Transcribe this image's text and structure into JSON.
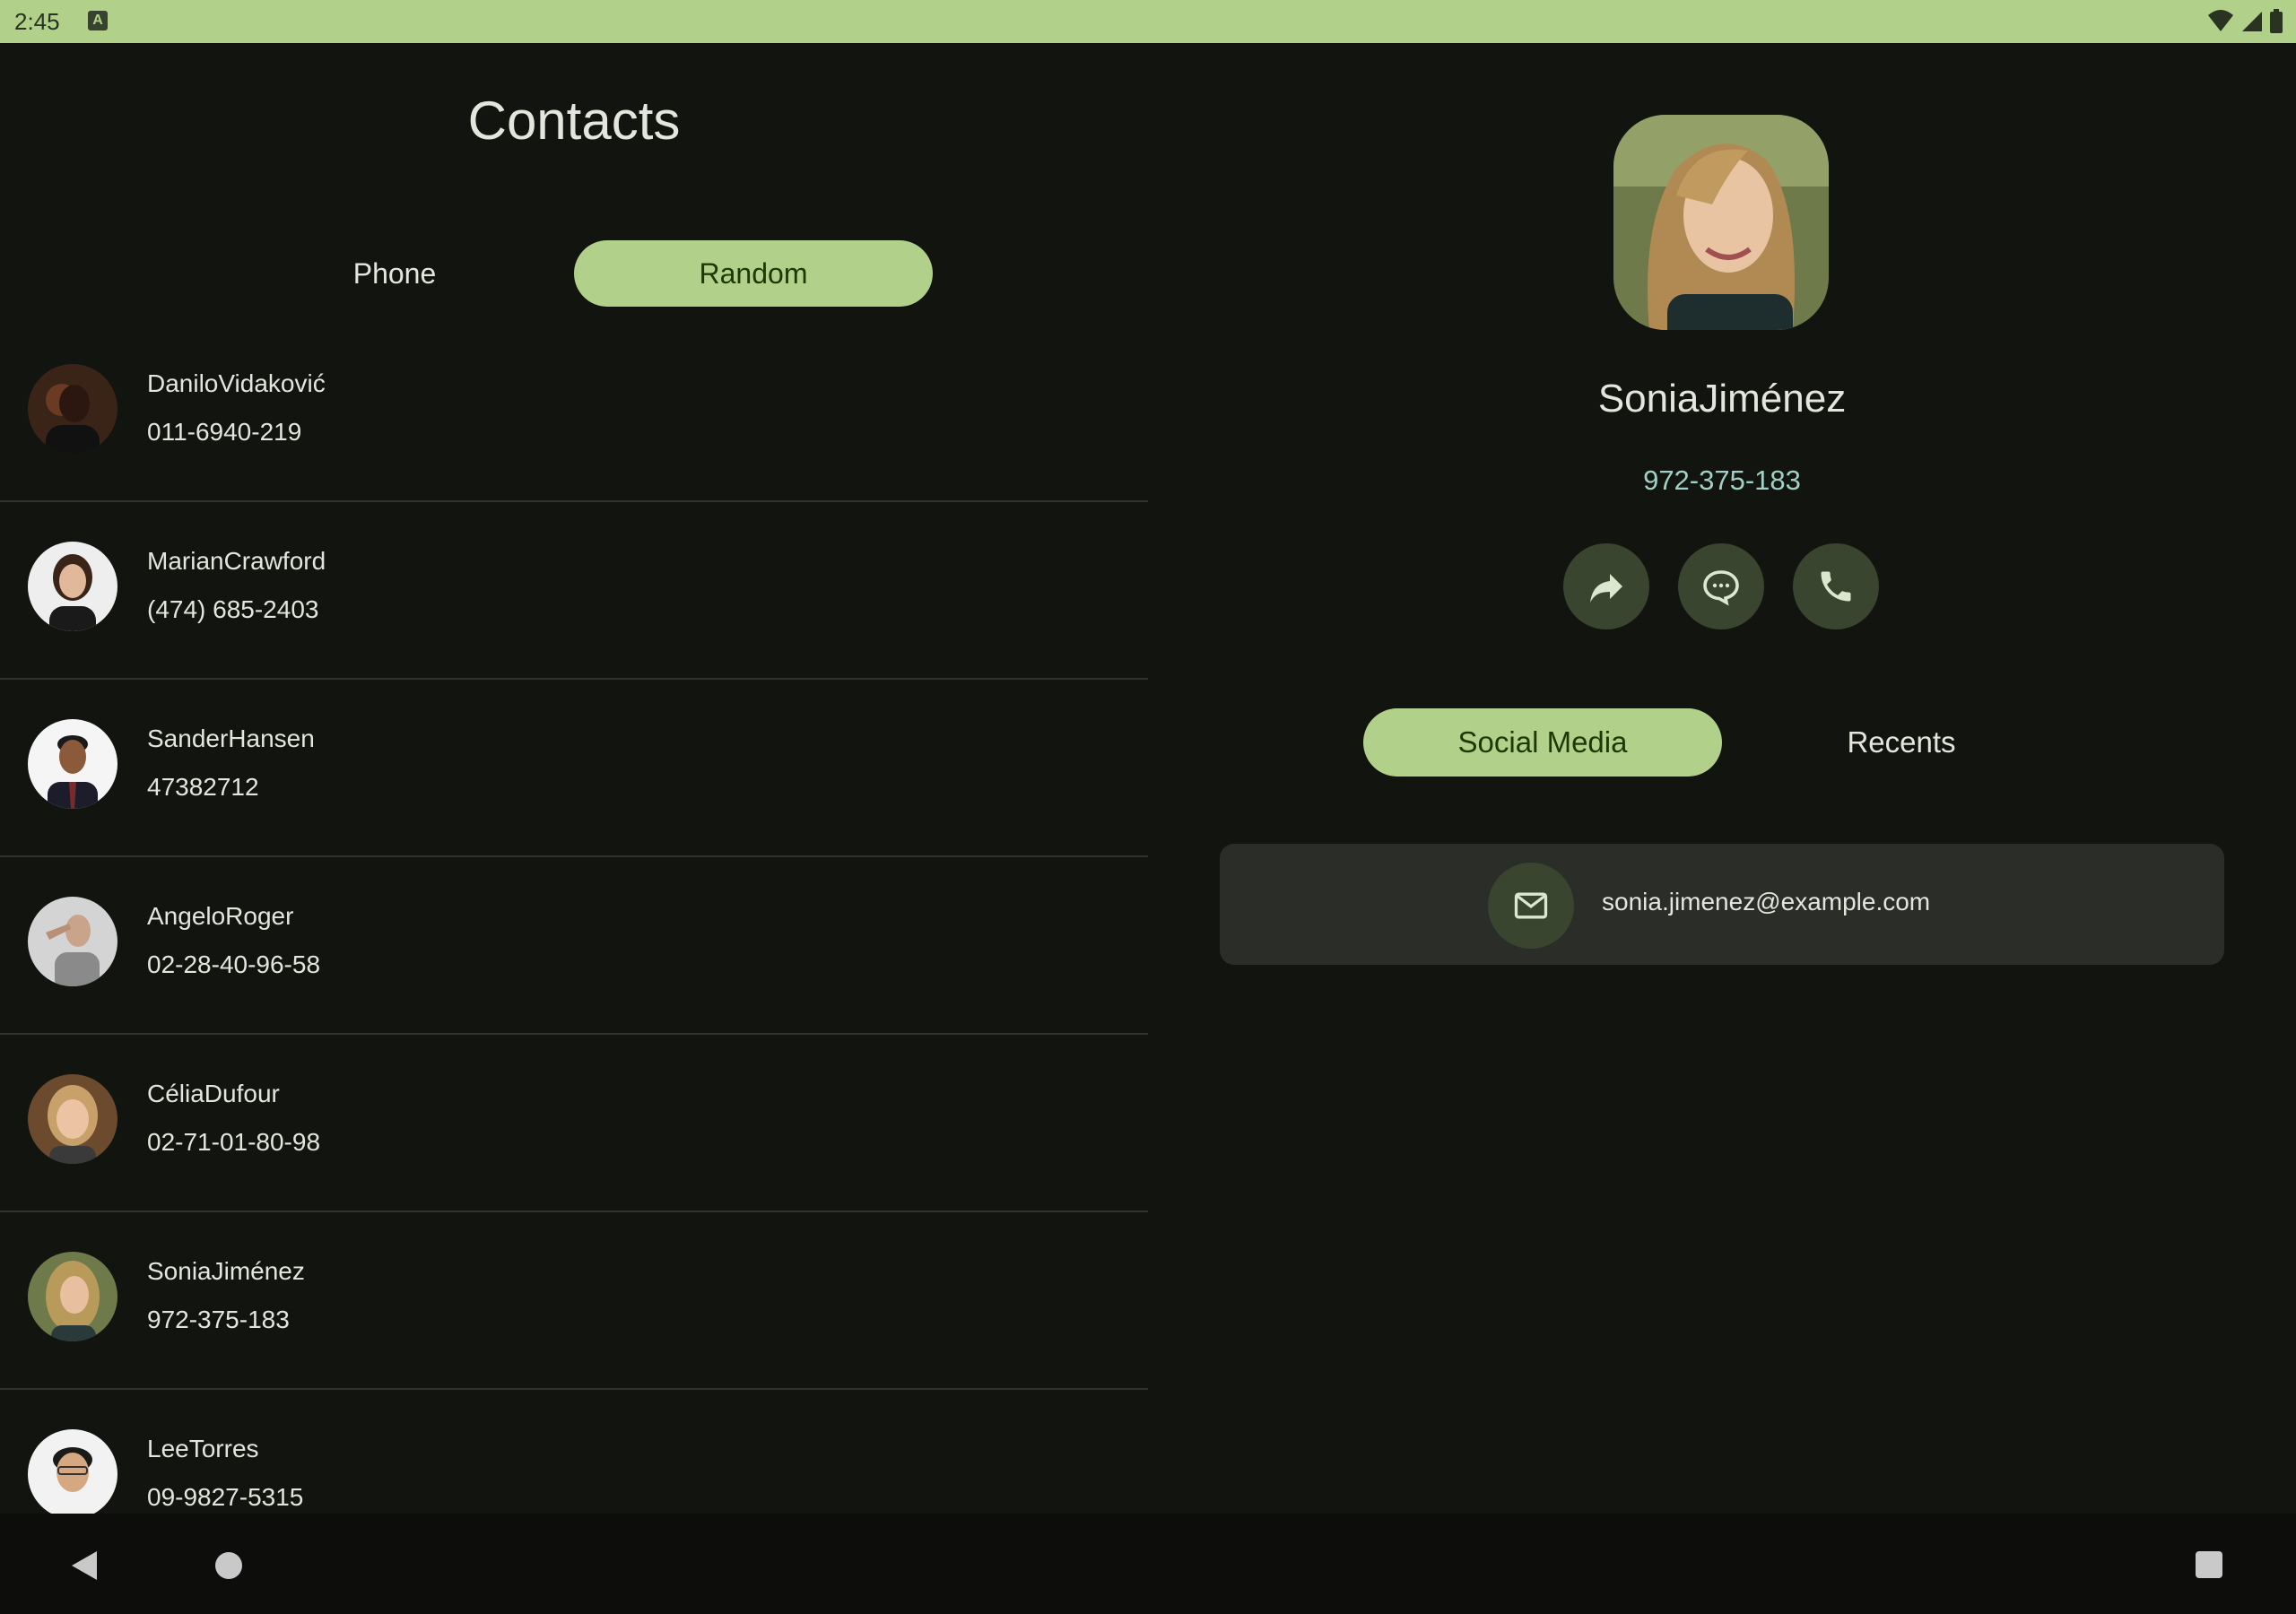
{
  "status_bar": {
    "time": "2:45",
    "notification_icon": "a-icon",
    "icons": [
      "wifi-icon",
      "signal-icon",
      "battery-icon"
    ]
  },
  "contacts": {
    "title": "Contacts",
    "tabs": [
      {
        "label": "Phone",
        "selected": false
      },
      {
        "label": "Random",
        "selected": true
      }
    ],
    "list": [
      {
        "name": "DaniloVidaković",
        "phone": "011-6940-219"
      },
      {
        "name": "MarianCrawford",
        "phone": "(474) 685-2403"
      },
      {
        "name": "SanderHansen",
        "phone": "47382712"
      },
      {
        "name": "AngeloRoger",
        "phone": "02-28-40-96-58"
      },
      {
        "name": "CéliaDufour",
        "phone": "02-71-01-80-98"
      },
      {
        "name": "SoniaJiménez",
        "phone": "972-375-183"
      },
      {
        "name": "LeeTorres",
        "phone": "09-9827-5315"
      }
    ]
  },
  "detail": {
    "name": "SoniaJiménez",
    "phone": "972-375-183",
    "actions": [
      "share-icon",
      "message-icon",
      "call-icon"
    ],
    "tabs": [
      {
        "label": "Social Media",
        "selected": true
      },
      {
        "label": "Recents",
        "selected": false
      }
    ],
    "email": "sonia.jimenez@example.com",
    "email_icon": "mail-icon"
  },
  "nav_bar": {
    "icons": [
      "back-icon",
      "home-icon",
      "recents-icon"
    ]
  },
  "colors": {
    "accent": "#b1d18a",
    "on_accent": "#1f3703",
    "background": "#121410",
    "phone_text": "#a0d0c6",
    "surface": "#2a2d28",
    "icon_container": "#39452f"
  }
}
